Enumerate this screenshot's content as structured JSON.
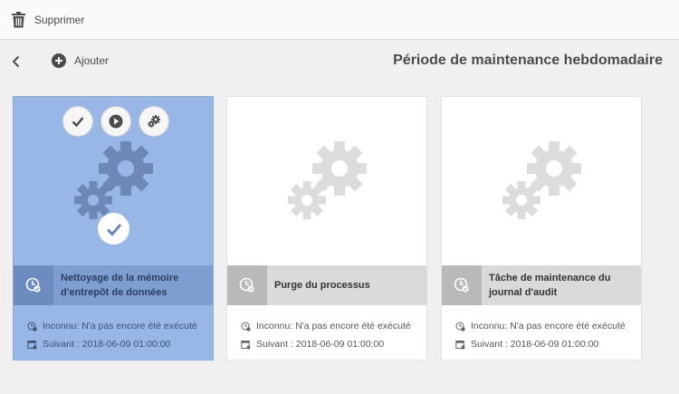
{
  "toolbar": {
    "delete_label": "Supprimer"
  },
  "subbar": {
    "add_label": "Ajouter",
    "page_title": "Période de maintenance hebdomadaire"
  },
  "colors": {
    "selected_card": "#98b7e6",
    "selected_band": "#7f9ed0",
    "gear_selected": "#6d87b6",
    "gear_default": "#dcdcdc"
  },
  "cards": [
    {
      "title_line1": "Nettoyage de la mémoire",
      "title_line2": "d'entrepôt de données",
      "status": "Inconnu: N'a pas encore été exécuté",
      "next": "Suivant : 2018-06-09 01:00:00",
      "selected": true,
      "icons": {
        "actions": [
          "checkmark-icon",
          "play-icon",
          "gear-icon"
        ],
        "type": "maintenance-task-icon"
      }
    },
    {
      "title_line1": "Purge du processus",
      "title_line2": "",
      "status": "Inconnu: N'a pas encore été exécuté",
      "next": "Suivant : 2018-06-09 01:00:00",
      "selected": false,
      "icons": {
        "type": "maintenance-task-icon"
      }
    },
    {
      "title_line1": "Tâche de maintenance du",
      "title_line2": "journal d'audit",
      "status": "Inconnu: N'a pas encore été exécuté",
      "next": "Suivant : 2018-06-09 01:00:00",
      "selected": false,
      "icons": {
        "type": "maintenance-task-icon"
      }
    }
  ]
}
